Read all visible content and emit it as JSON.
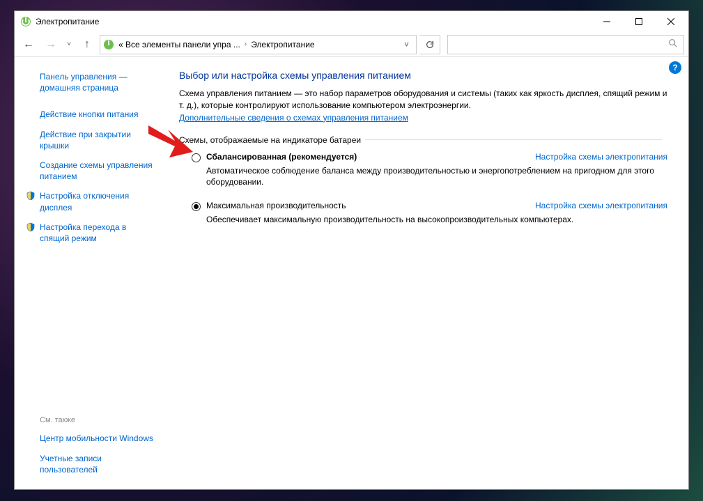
{
  "window": {
    "title": "Электропитание"
  },
  "breadcrumb": {
    "root": "« Все элементы панели упра ...",
    "current": "Электропитание"
  },
  "sidebar": {
    "home": "Панель управления — домашняя страница",
    "links": [
      "Действие кнопки питания",
      "Действие при закрытии крышки",
      "Создание схемы управления питанием",
      "Настройка отключения дисплея",
      "Настройка перехода в спящий режим"
    ],
    "see_also_label": "См. также",
    "see_also": [
      "Центр мобильности Windows",
      "Учетные записи пользователей"
    ]
  },
  "main": {
    "heading": "Выбор или настройка схемы управления питанием",
    "description": "Схема управления питанием — это набор параметров оборудования и системы (таких как яркость дисплея, спящий режим и т. д.), которые контролируют использование компьютером электроэнергии.",
    "learn_more": "Дополнительные сведения о схемах управления питанием",
    "group_label": "Схемы, отображаемые на индикаторе батареи",
    "plans": [
      {
        "name": "Сбалансированная (рекомендуется)",
        "link": "Настройка схемы электропитания",
        "desc": "Автоматическое соблюдение баланса между производительностью и энергопотреблением на пригодном для этого оборудовании.",
        "selected": false
      },
      {
        "name": "Максимальная производительность",
        "link": "Настройка схемы электропитания",
        "desc": "Обеспечивает максимальную производительность на высокопроизводительных компьютерах.",
        "selected": true
      }
    ]
  }
}
